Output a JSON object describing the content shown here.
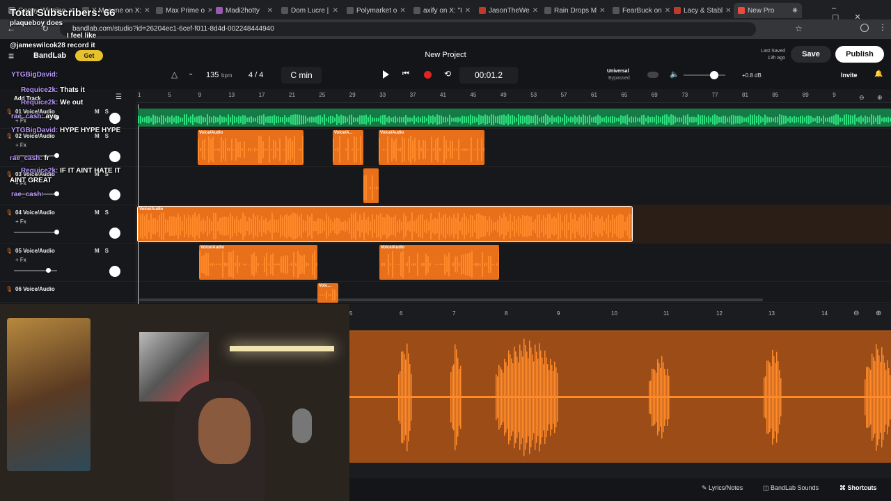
{
  "browser": {
    "tabs": [
      {
        "label": "Genny Winning",
        "color": "#777"
      },
      {
        "label": "X Macune on X:",
        "color": "#555"
      },
      {
        "label": "Max Prime o",
        "color": "#555"
      },
      {
        "label": "Madi2hotty",
        "color": "#9b59b6"
      },
      {
        "label": "Dom Lucre |",
        "color": "#555"
      },
      {
        "label": "Polymarket o",
        "color": "#555"
      },
      {
        "label": "axify on X: \"I",
        "color": "#555"
      },
      {
        "label": "JasonTheWe",
        "color": "#c0392b"
      },
      {
        "label": "Rain Drops M",
        "color": "#555"
      },
      {
        "label": "FearBuck on",
        "color": "#555"
      },
      {
        "label": "Lacy & Stabl",
        "color": "#c0392b"
      },
      {
        "label": "New Pro",
        "color": "#e74c3c",
        "active": true
      }
    ],
    "url": "bandlab.com/studio?id=26204ec1-6cef-f011-8d4d-002248444940"
  },
  "header": {
    "project_title": "New Project",
    "last_saved_label": "Last Saved",
    "last_saved_time": "13h ago",
    "save_label": "Save",
    "publish_label": "Publish",
    "invite_label": "Invite",
    "brand": "BandLab",
    "get_label": "Get"
  },
  "transport": {
    "bpm": "135",
    "bpm_unit": "bpm",
    "time_signature": "4 / 4",
    "key": "C min",
    "time": "00:01.2",
    "preset_name": "Universal",
    "preset_state": "Bypassed",
    "master_gain": "+0.8 dB",
    "add_track_label": "Add Track"
  },
  "ruler": {
    "ticks": [
      "1",
      "5",
      "9",
      "13",
      "17",
      "21",
      "25",
      "29",
      "33",
      "37",
      "41",
      "45",
      "49",
      "53",
      "57",
      "61",
      "65",
      "69",
      "73",
      "77",
      "81",
      "85",
      "89",
      "9"
    ]
  },
  "tracks": [
    {
      "num": "01",
      "name": "Voice/Audio",
      "fx": "+ Fx"
    },
    {
      "num": "02",
      "name": "Voice/Audio",
      "fx": "+ Fx"
    },
    {
      "num": "03",
      "name": "Voice/Audio",
      "fx": "+ Fx"
    },
    {
      "num": "04",
      "name": "Voice/Audio",
      "fx": "+ Fx"
    },
    {
      "num": "05",
      "name": "Voice/Audio",
      "fx": "+ Fx"
    },
    {
      "num": "06",
      "name": "Voice/Audio",
      "fx": "+ Fx"
    }
  ],
  "clip_label": "Voice/Audio",
  "clip_label_short": "Voice/A...",
  "clip_label_tiny": "Voic...",
  "ms": "MS",
  "editor": {
    "ticks": [
      "5",
      "6",
      "7",
      "8",
      "9",
      "10",
      "11",
      "12",
      "13",
      "14"
    ]
  },
  "footer": {
    "lyrics": "Lyrics/Notes",
    "sounds": "BandLab Sounds",
    "shortcuts": "Shortcuts"
  },
  "overlay": {
    "subscribers": "Total Subscribers: 66",
    "chat": [
      {
        "user": "",
        "text": "plaqueboy does"
      },
      {
        "user": "",
        "text": "I feel like"
      },
      {
        "user": "",
        "text": "@jameswilcok28 record it"
      },
      {
        "user": "YTGBigDavid:",
        "text": ""
      },
      {
        "user": "Requice2k:",
        "text": "Thats it"
      },
      {
        "user": "Requice2k:",
        "text": "We out"
      },
      {
        "user": "rae_cash:",
        "text": "aye"
      },
      {
        "user": "YTGBigDavid:",
        "text": "HYPE HYPE HYPE"
      },
      {
        "user": "rae_cash:",
        "text": "fr"
      },
      {
        "user": "Requice2k:",
        "text": "IF IT AINT HATE IT"
      },
      {
        "user": "",
        "text": "AINT GREAT"
      },
      {
        "user": "rae_cash:",
        "text": ""
      }
    ]
  },
  "colors": {
    "accent": "#e8701a",
    "green_track": "#1ec46a",
    "record": "#e02424"
  }
}
